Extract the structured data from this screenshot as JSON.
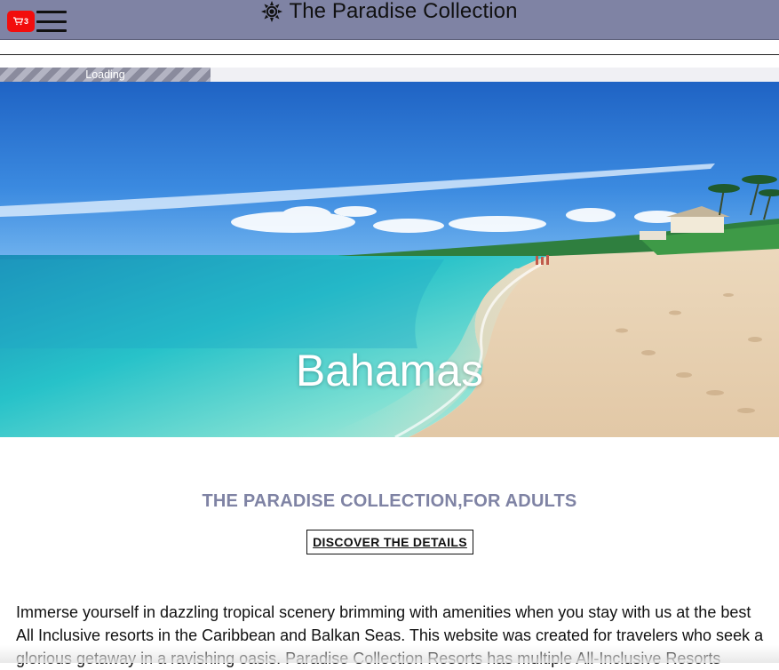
{
  "header": {
    "cart_count": "3",
    "brand_title": "The Paradise Collection"
  },
  "loading": {
    "label": "Loading",
    "progress_fraction": 0.27
  },
  "hero": {
    "title": "Bahamas"
  },
  "content": {
    "tagline": "THE PARADISE COLLECTION,FOR ADULTS",
    "discover_label": "DISCOVER THE DETAILS",
    "intro": "Immerse yourself in dazzling tropical scenery brimming with amenities when you stay with us at the best All Inclusive resorts in the Caribbean and Balkan Seas. This website was created for travelers who seek a glorious getaway in a ravishing oasis. Paradise Collection Resorts has multiple All-Inclusive Resorts"
  },
  "colors": {
    "header_bg": "#7f83a4",
    "cart_badge": "#f20d0d",
    "tagline": "#7f83a4"
  },
  "icons": {
    "cart": "cart-icon",
    "menu": "hamburger-menu-icon",
    "brand": "sun-icon"
  }
}
